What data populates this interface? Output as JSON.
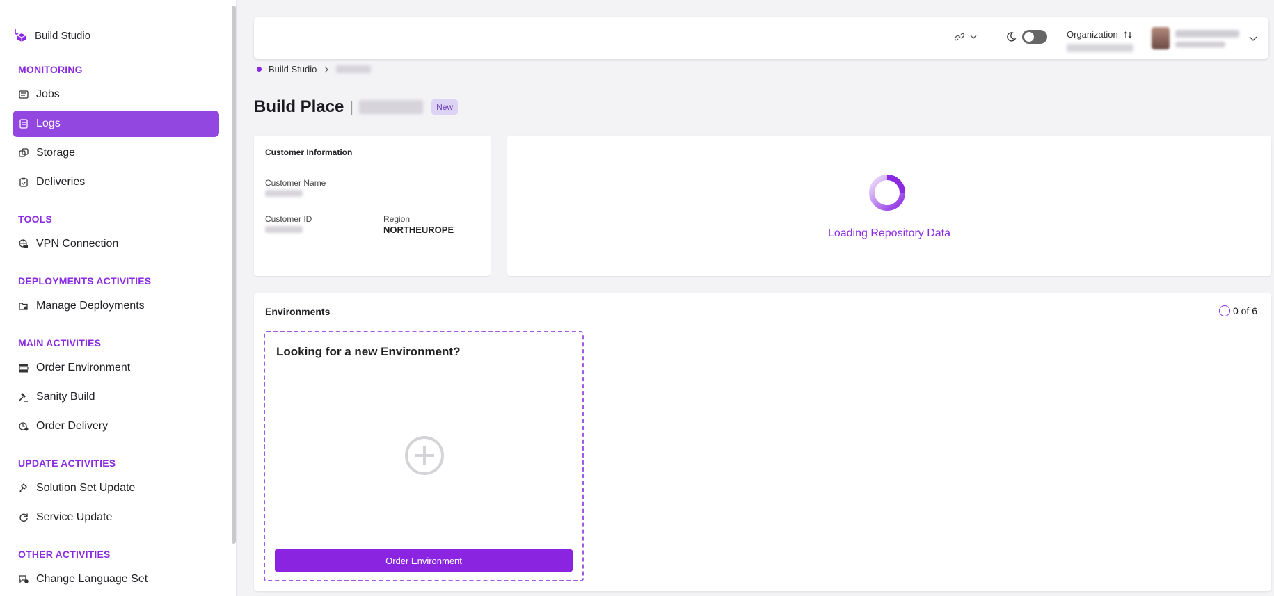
{
  "sidebar": {
    "brand": "Build Studio",
    "sections": [
      {
        "title": "MONITORING",
        "items": [
          {
            "label": "Jobs",
            "icon": "jobs-icon"
          },
          {
            "label": "Logs",
            "icon": "logs-icon",
            "active": true
          },
          {
            "label": "Storage",
            "icon": "storage-icon"
          },
          {
            "label": "Deliveries",
            "icon": "deliveries-icon"
          }
        ]
      },
      {
        "title": "TOOLS",
        "items": [
          {
            "label": "VPN Connection",
            "icon": "vpn-icon"
          }
        ]
      },
      {
        "title": "DEPLOYMENTS ACTIVITIES",
        "items": [
          {
            "label": "Manage Deployments",
            "icon": "deployments-icon"
          }
        ]
      },
      {
        "title": "MAIN ACTIVITIES",
        "items": [
          {
            "label": "Order Environment",
            "icon": "server-stack-icon"
          },
          {
            "label": "Sanity Build",
            "icon": "gavel-icon"
          },
          {
            "label": "Order Delivery",
            "icon": "delivery-icon"
          }
        ]
      },
      {
        "title": "UPDATE ACTIVITIES",
        "items": [
          {
            "label": "Solution Set Update",
            "icon": "update-icon"
          },
          {
            "label": "Service Update",
            "icon": "refresh-icon"
          }
        ]
      },
      {
        "title": "OTHER ACTIVITIES",
        "items": [
          {
            "label": "Change Language Set",
            "icon": "language-icon"
          }
        ]
      }
    ]
  },
  "topbar": {
    "organization_label": "Organization"
  },
  "breadcrumb": {
    "root": "Build Studio"
  },
  "page": {
    "title": "Build Place",
    "badge": "New"
  },
  "customer_info": {
    "title": "Customer Information",
    "name_label": "Customer Name",
    "id_label": "Customer ID",
    "region_label": "Region",
    "region_value": "NORTHEUROPE"
  },
  "repository": {
    "loading_text": "Loading Repository Data"
  },
  "environments": {
    "title": "Environments",
    "count": "0 of 6",
    "new_env_heading": "Looking for a new Environment?",
    "order_button": "Order Environment"
  },
  "colors": {
    "accent": "#8a2be2",
    "active_nav": "#9147e0"
  }
}
